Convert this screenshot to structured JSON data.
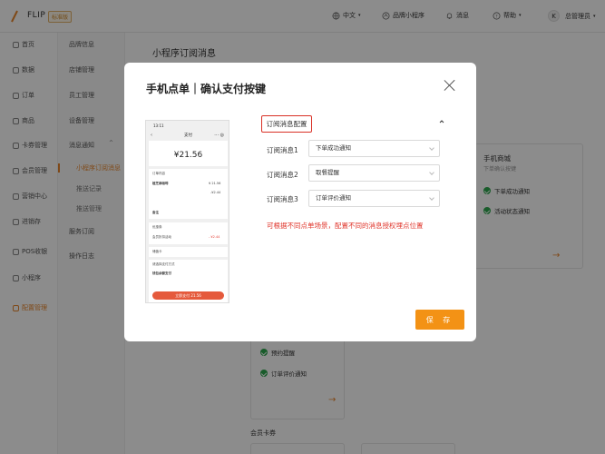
{
  "topbar": {
    "logo_text": "FLIP",
    "logo_badge": "标准版",
    "language": "中文",
    "mini_program": "品牌小程序",
    "messages": "消息",
    "help": "帮助",
    "avatar_letter": "K",
    "user": "总管理员"
  },
  "sidebar": {
    "items": [
      {
        "label": "首页"
      },
      {
        "label": "数据"
      },
      {
        "label": "订单"
      },
      {
        "label": "商品"
      },
      {
        "label": "卡券管理"
      },
      {
        "label": "会员管理"
      },
      {
        "label": "营销中心"
      },
      {
        "label": "进销存"
      },
      {
        "label": "POS收银"
      },
      {
        "label": "小程序"
      },
      {
        "label": "配置管理"
      }
    ]
  },
  "subnav": {
    "items": [
      {
        "label": "品牌信息"
      },
      {
        "label": "店铺管理"
      },
      {
        "label": "员工管理"
      },
      {
        "label": "设备管理"
      },
      {
        "label": "消息通知"
      },
      {
        "label": "服务订阅"
      },
      {
        "label": "操作日志"
      }
    ],
    "children": [
      {
        "label": "小程序订阅消息"
      },
      {
        "label": "推送记录"
      },
      {
        "label": "推送管理"
      }
    ]
  },
  "main": {
    "title": "小程序订阅消息",
    "card_title": "手机商城",
    "card_subtitle": "下单确认按键",
    "card_checks": [
      "下单成功通知",
      "活动状态通知"
    ],
    "lower_checks": [
      "预约提醒",
      "订单评价通知"
    ],
    "section2": "会员卡券"
  },
  "modal": {
    "title": "手机点单｜确认支付按键",
    "config_title": "订阅消息配置",
    "rows": [
      {
        "label": "订阅消息1",
        "value": "下单成功通知"
      },
      {
        "label": "订阅消息2",
        "value": "取餐提醒"
      },
      {
        "label": "订阅消息3",
        "value": "订单评价通知"
      }
    ],
    "note": "可根据不同点单场景，配置不同的消息授权埋点位置",
    "save": "保 存"
  },
  "phone": {
    "time": "13:11",
    "title": "支付",
    "amount": "¥21.56",
    "order_header": "订单内容",
    "item_name": "植芝麻咖啡",
    "item_price": "¥ 21.56",
    "discount": "-¥2.44",
    "note_label": "备注",
    "coupon_label": "优惠券",
    "coupon_value": "会员折扣活动",
    "coupon_amount": "- ¥2.44",
    "gift_card": "储值卡",
    "pay_method": "请选择支付方式",
    "pay_option": "钱包余额支付",
    "pay_button": "立即支付 21.56"
  },
  "colors": {
    "accent": "#f39215",
    "danger": "#e0352b",
    "success": "#2fa84f"
  }
}
